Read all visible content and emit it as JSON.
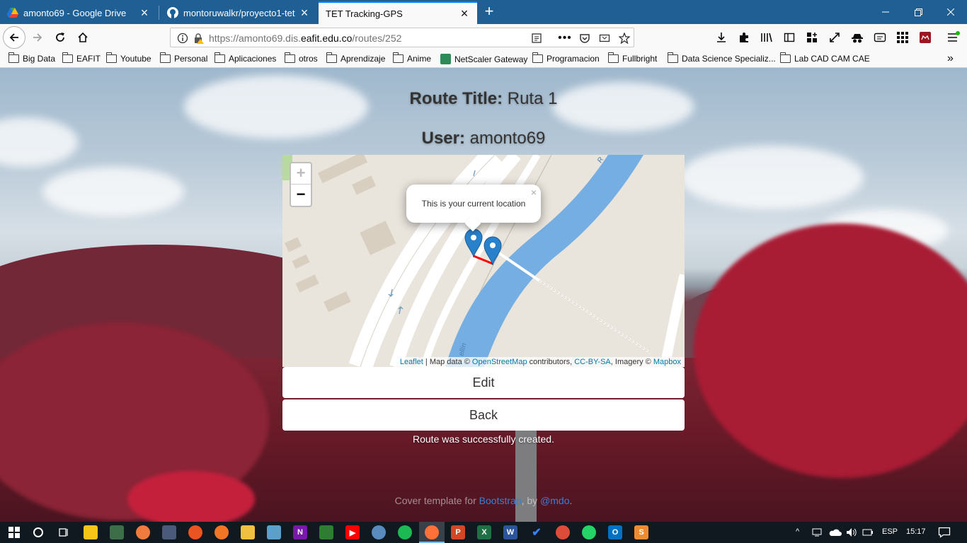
{
  "browser": {
    "tabs": [
      {
        "label": "amonto69 - Google Drive",
        "icon": "google-drive-icon"
      },
      {
        "label": "montoruwalkr/proyecto1-tet",
        "icon": "github-icon"
      },
      {
        "label": "TET Tracking-GPS",
        "icon": "none",
        "active": true
      }
    ],
    "url_prefix": "https://amonto69.dis.",
    "url_domain": "eafit.edu.co",
    "url_path": "/routes/252",
    "bookmarks": [
      "Big Data",
      "EAFIT",
      "Youtube",
      "Personal",
      "Aplicaciones",
      "otros",
      "Aprendizaje",
      "Anime",
      "NetScaler Gateway",
      "Programacion",
      "Fullbright",
      "Data Science Specializ...",
      "Lab CAD CAM CAE"
    ]
  },
  "page": {
    "route_title_label": "Route Title:",
    "route_title_value": "Ruta 1",
    "user_label": "User:",
    "user_value": "amonto69",
    "map": {
      "zoom_in": "+",
      "zoom_out": "−",
      "popup_text": "This is your current location",
      "popup_close": "×",
      "river_label_top": "R",
      "river_label_bottom": "ellín",
      "attribution": {
        "leaflet": "Leaflet",
        "sep1": " | Map data © ",
        "osm": "OpenStreetMap",
        "contributors": " contributors, ",
        "license": "CC-BY-SA",
        "imagery": ", Imagery © ",
        "mapbox": "Mapbox"
      }
    },
    "edit_button": "Edit",
    "back_button": "Back",
    "notice": "Route was successfully created.",
    "footer": {
      "prefix": "Cover template for ",
      "bootstrap": "Bootstrap",
      "by": ", by ",
      "author": "@mdo",
      "suffix": "."
    }
  },
  "taskbar": {
    "language": "ESP",
    "time": "15:17"
  }
}
